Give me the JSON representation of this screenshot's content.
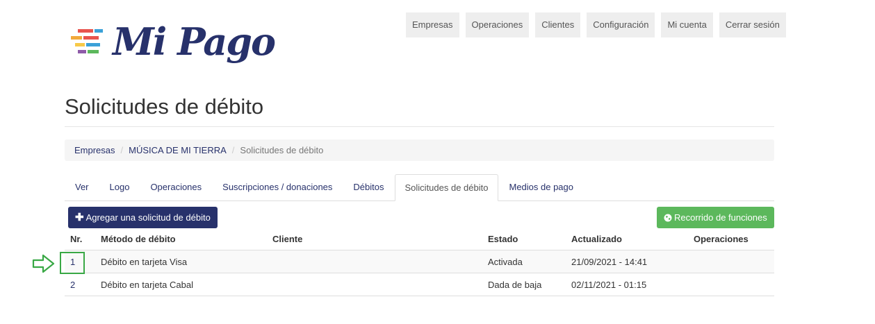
{
  "brand": {
    "name": "Mi Pago"
  },
  "topnav": [
    "Empresas",
    "Operaciones",
    "Clientes",
    "Configuración",
    "Mi cuenta",
    "Cerrar sesión"
  ],
  "page": {
    "title": "Solicitudes de débito"
  },
  "breadcrumb": [
    "Empresas",
    "MÚSICA DE MI TIERRA",
    "Solicitudes de débito"
  ],
  "tabs": [
    "Ver",
    "Logo",
    "Operaciones",
    "Suscripciones / donaciones",
    "Débitos",
    "Solicitudes de débito",
    "Medios de pago"
  ],
  "actions": {
    "add_label": "Agregar una solicitud de débito",
    "tour_label": "Recorrido de funciones"
  },
  "table": {
    "headers": [
      "Nr.",
      "Método de débito",
      "Cliente",
      "Estado",
      "Actualizado",
      "Operaciones"
    ],
    "rows": [
      {
        "nr": "1",
        "metodo": "Débito en tarjeta Visa",
        "cliente": "",
        "estado": "Activada",
        "actualizado": "21/09/2021 - 14:41",
        "operaciones": ""
      },
      {
        "nr": "2",
        "metodo": "Débito en tarjeta Cabal",
        "cliente": "",
        "estado": "Dada de baja",
        "actualizado": "02/11/2021 - 01:15",
        "operaciones": ""
      }
    ]
  },
  "colors": {
    "brand": "#27316b",
    "success": "#5cb85c",
    "highlight": "#39a845"
  }
}
